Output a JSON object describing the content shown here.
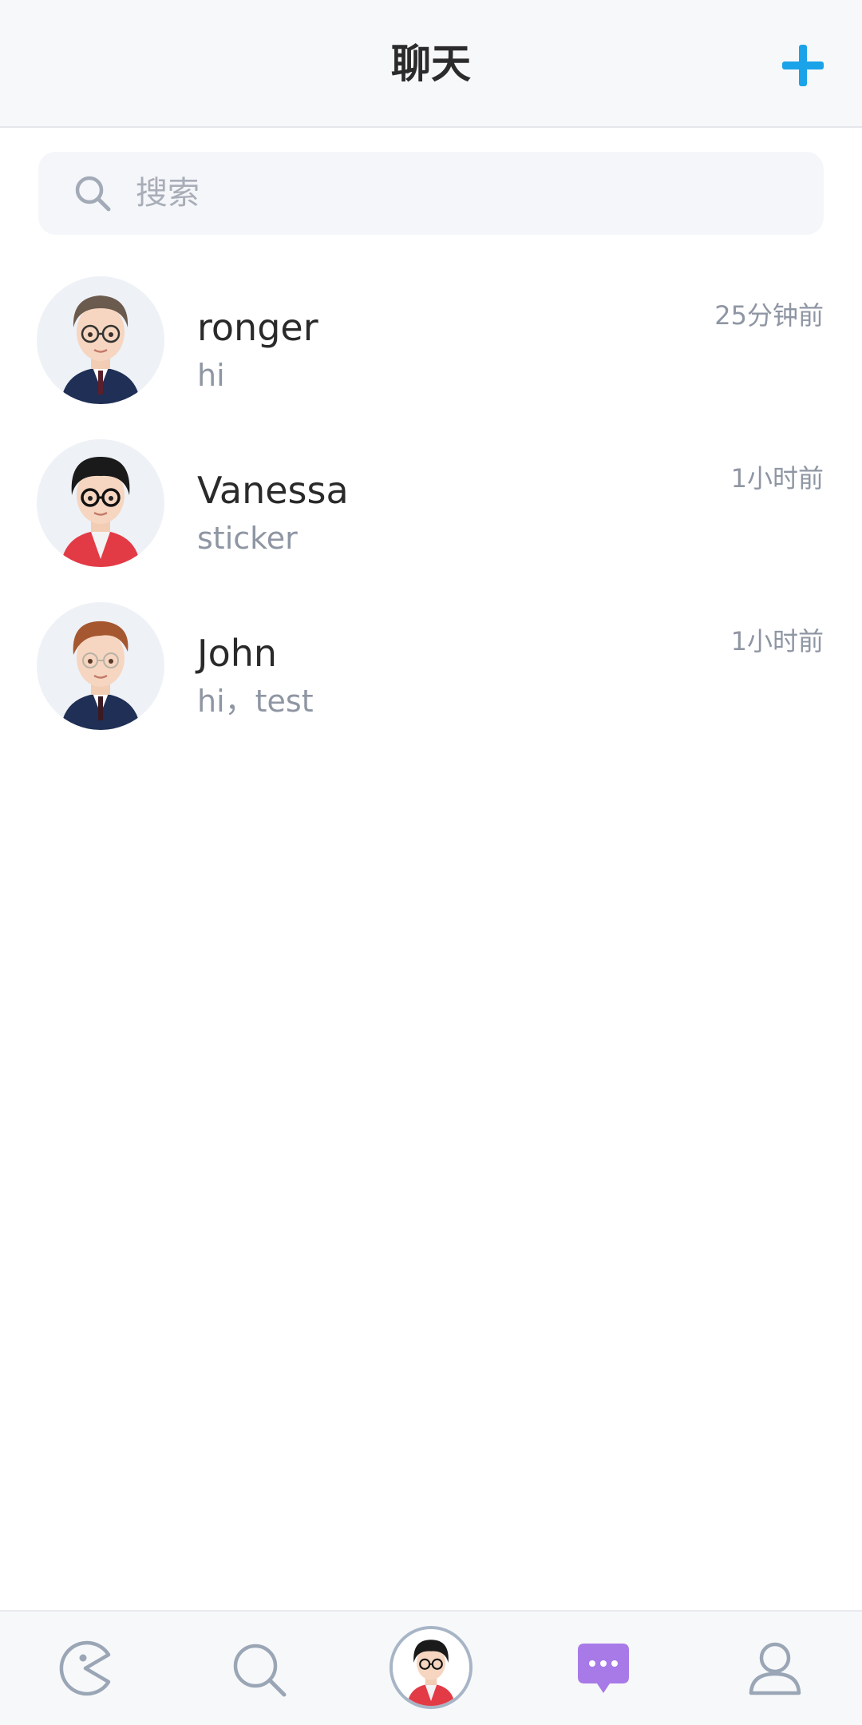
{
  "header": {
    "title": "聊天",
    "add_icon": "plus-icon",
    "accent_color": "#1aa3e8"
  },
  "search": {
    "placeholder": "搜索",
    "icon": "search-icon"
  },
  "chats": [
    {
      "name": "ronger",
      "preview": "hi",
      "time": "25分钟前",
      "avatar": "avatar-boy-suit-glasses"
    },
    {
      "name": "Vanessa",
      "preview": "sticker",
      "time": "1小时前",
      "avatar": "avatar-boy-red-jacket"
    },
    {
      "name": "John",
      "preview": "hi，test",
      "time": "1小时前",
      "avatar": "avatar-boy-suit-ginger"
    }
  ],
  "bottom_nav": {
    "items": [
      {
        "icon": "pacman-icon"
      },
      {
        "icon": "search-icon"
      },
      {
        "icon": "profile-avatar"
      },
      {
        "icon": "chat-bubble-icon",
        "active": true
      },
      {
        "icon": "user-icon"
      }
    ],
    "active_color": "#a77ae8",
    "inactive_color": "#9aa6b5"
  }
}
